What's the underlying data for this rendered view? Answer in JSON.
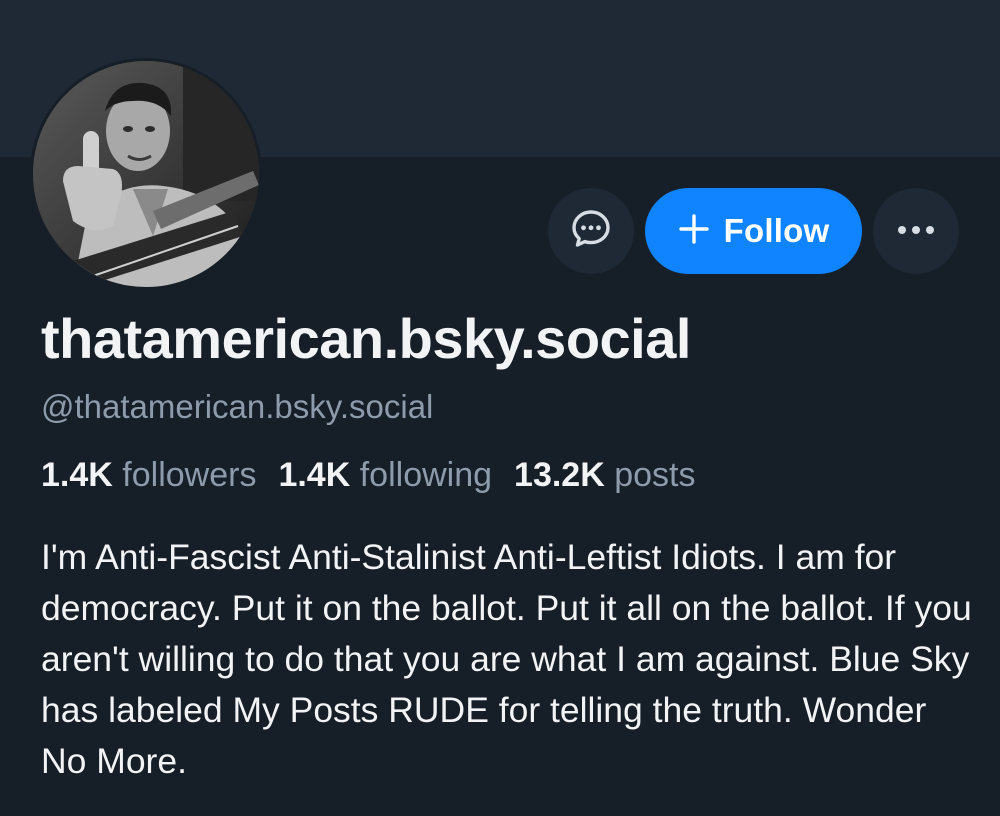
{
  "profile": {
    "display_name": "thatamerican.bsky.social",
    "handle": "@thatamerican.bsky.social",
    "avatar_icon": "profile-photo",
    "bio": "I'm Anti-Fascist Anti-Stalinist Anti-Leftist Idiots. I am for democracy. Put it on the ballot. Put it all on the ballot. If you aren't willing to do that you are what I am against. Blue Sky has labeled My Posts RUDE for telling the truth. Wonder No More."
  },
  "stats": {
    "followers_count": "1.4K",
    "followers_label": "followers",
    "following_count": "1.4K",
    "following_label": "following",
    "posts_count": "13.2K",
    "posts_label": "posts"
  },
  "actions": {
    "message_icon": "chat-bubble-icon",
    "follow_label": "Follow",
    "follow_icon": "plus-icon",
    "more_icon": "ellipsis-icon"
  },
  "colors": {
    "background": "#161e27",
    "banner": "#1e2935",
    "accent": "#1083fe",
    "text_primary": "#f1f3f5",
    "text_secondary": "#8d9bab"
  }
}
